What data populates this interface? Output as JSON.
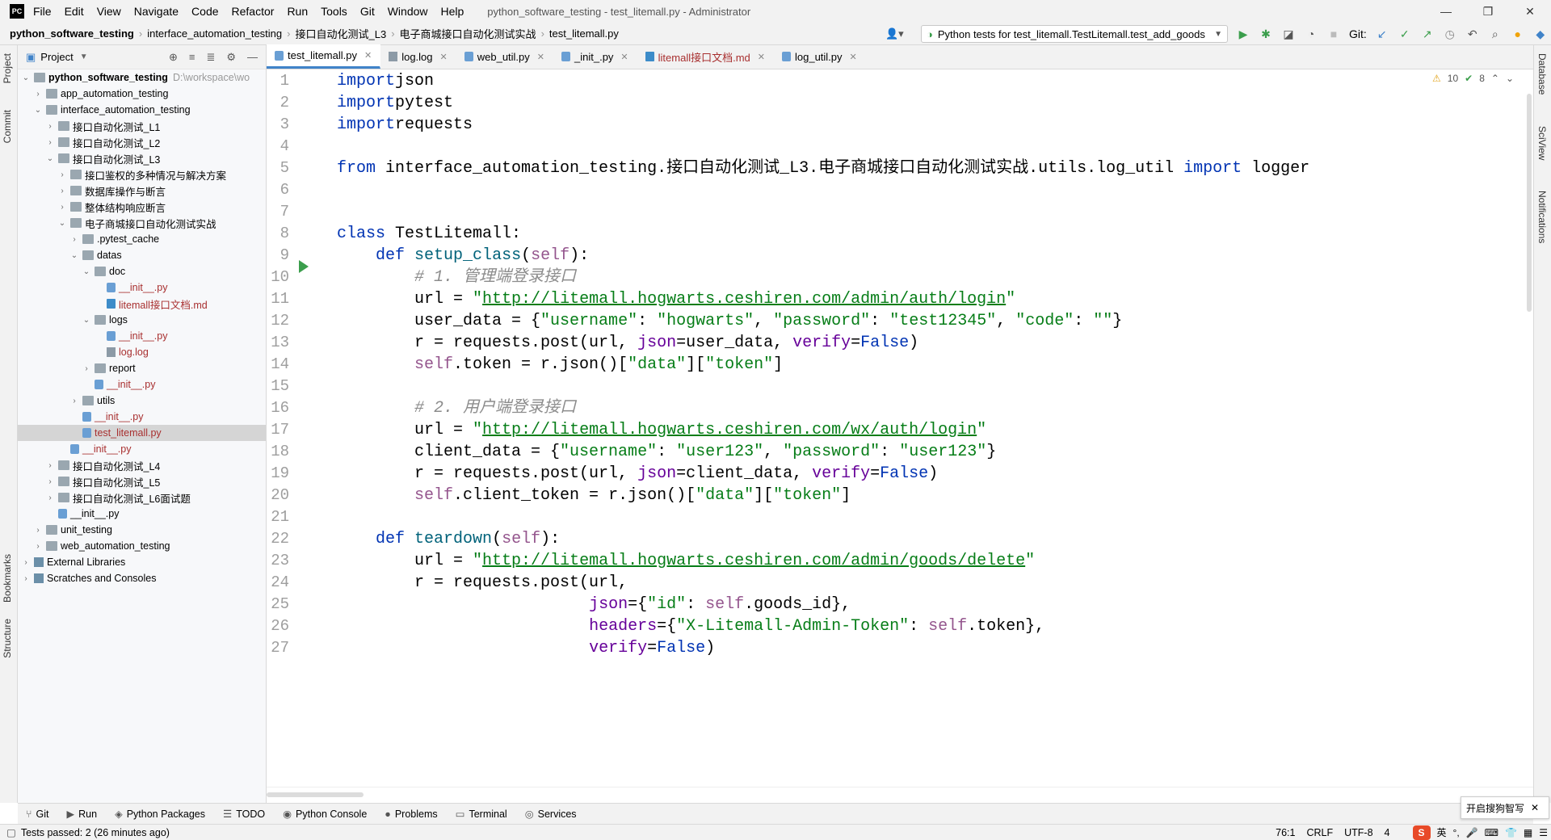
{
  "menubar": {
    "logo": "PC",
    "items": [
      "File",
      "Edit",
      "View",
      "Navigate",
      "Code",
      "Refactor",
      "Run",
      "Tools",
      "Git",
      "Window",
      "Help"
    ],
    "title": "python_software_testing - test_litemall.py - Administrator",
    "controls": [
      "—",
      "❐",
      "✕"
    ]
  },
  "navbar": {
    "breadcrumbs": [
      "python_software_testing",
      "interface_automation_testing",
      "接口自动化测试_L3",
      "电子商城接口自动化测试实战",
      "test_litemall.py"
    ],
    "run_config": "Python tests for test_litemall.TestLitemall.test_add_goods",
    "git_label": "Git:"
  },
  "left_strip": {
    "tabs": [
      "Project",
      "Commit",
      "Bookmarks",
      "Structure"
    ]
  },
  "right_strip": {
    "tabs": [
      "Database",
      "SciView",
      "Notifications"
    ]
  },
  "project": {
    "title": "Project",
    "tree": [
      {
        "label": "python_software_testing",
        "path": "D:\\workspace\\wo",
        "depth": 0,
        "chev": "v",
        "icon": "folder",
        "bold": true
      },
      {
        "label": "app_automation_testing",
        "depth": 1,
        "chev": ">",
        "icon": "folder"
      },
      {
        "label": "interface_automation_testing",
        "depth": 1,
        "chev": "v",
        "icon": "folder"
      },
      {
        "label": "接口自动化测试_L1",
        "depth": 2,
        "chev": ">",
        "icon": "folder"
      },
      {
        "label": "接口自动化测试_L2",
        "depth": 2,
        "chev": ">",
        "icon": "folder"
      },
      {
        "label": "接口自动化测试_L3",
        "depth": 2,
        "chev": "v",
        "icon": "folder"
      },
      {
        "label": "接口鉴权的多种情况与解决方案",
        "depth": 3,
        "chev": ">",
        "icon": "folder"
      },
      {
        "label": "数据库操作与断言",
        "depth": 3,
        "chev": ">",
        "icon": "folder"
      },
      {
        "label": "整体结构响应断言",
        "depth": 3,
        "chev": ">",
        "icon": "folder"
      },
      {
        "label": "电子商城接口自动化测试实战",
        "depth": 3,
        "chev": "v",
        "icon": "folder"
      },
      {
        "label": ".pytest_cache",
        "depth": 4,
        "chev": ">",
        "icon": "folder"
      },
      {
        "label": "datas",
        "depth": 4,
        "chev": "v",
        "icon": "folder"
      },
      {
        "label": "doc",
        "depth": 5,
        "chev": "v",
        "icon": "folder"
      },
      {
        "label": "__init__.py",
        "depth": 6,
        "chev": "",
        "icon": "py",
        "red": true
      },
      {
        "label": "litemall接口文档.md",
        "depth": 6,
        "chev": "",
        "icon": "md",
        "red": true
      },
      {
        "label": "logs",
        "depth": 5,
        "chev": "v",
        "icon": "folder"
      },
      {
        "label": "__init__.py",
        "depth": 6,
        "chev": "",
        "icon": "py",
        "red": true
      },
      {
        "label": "log.log",
        "depth": 6,
        "chev": "",
        "icon": "log",
        "red": true
      },
      {
        "label": "report",
        "depth": 5,
        "chev": ">",
        "icon": "folder"
      },
      {
        "label": "__init__.py",
        "depth": 5,
        "chev": "",
        "icon": "py",
        "red": true
      },
      {
        "label": "utils",
        "depth": 4,
        "chev": ">",
        "icon": "folder"
      },
      {
        "label": "__init__.py",
        "depth": 4,
        "chev": "",
        "icon": "py",
        "red": true
      },
      {
        "label": "test_litemall.py",
        "depth": 4,
        "chev": "",
        "icon": "py",
        "red": true,
        "selected": true
      },
      {
        "label": "__init__.py",
        "depth": 3,
        "chev": "",
        "icon": "py",
        "red": true
      },
      {
        "label": "接口自动化测试_L4",
        "depth": 2,
        "chev": ">",
        "icon": "folder"
      },
      {
        "label": "接口自动化测试_L5",
        "depth": 2,
        "chev": ">",
        "icon": "folder"
      },
      {
        "label": "接口自动化测试_L6面试题",
        "depth": 2,
        "chev": ">",
        "icon": "folder"
      },
      {
        "label": "__init__.py",
        "depth": 2,
        "chev": "",
        "icon": "py"
      },
      {
        "label": "unit_testing",
        "depth": 1,
        "chev": ">",
        "icon": "folder"
      },
      {
        "label": "web_automation_testing",
        "depth": 1,
        "chev": ">",
        "icon": "folder"
      },
      {
        "label": "External Libraries",
        "depth": 0,
        "chev": ">",
        "icon": "lib"
      },
      {
        "label": "Scratches and Consoles",
        "depth": 0,
        "chev": ">",
        "icon": "lib"
      }
    ]
  },
  "tabs": [
    {
      "label": "test_litemall.py",
      "active": true,
      "icon": "py"
    },
    {
      "label": "log.log",
      "icon": "log"
    },
    {
      "label": "web_util.py",
      "icon": "py"
    },
    {
      "label": "_init_.py",
      "icon": "py"
    },
    {
      "label": "litemall接口文档.md",
      "icon": "md",
      "red": true
    },
    {
      "label": "log_util.py",
      "icon": "py"
    }
  ],
  "inspection": {
    "warnings": "10",
    "ok": "8"
  },
  "code_lines": [
    [
      [
        "kw",
        "import"
      ],
      [
        "",
        "json"
      ]
    ],
    [
      [
        "kw",
        "import"
      ],
      [
        "",
        "pytest"
      ]
    ],
    [
      [
        "kw",
        "import"
      ],
      [
        "",
        "requests"
      ]
    ],
    [],
    [
      [
        "kw",
        "from"
      ],
      [
        "",
        " interface_automation_testing.接口自动化测试_L3.电子商城接口自动化测试实战.utils.log_util "
      ],
      [
        "kw",
        "import"
      ],
      [
        "",
        " logger"
      ]
    ],
    [],
    [],
    [
      [
        "kw",
        "class"
      ],
      [
        "",
        " TestLitemall:"
      ]
    ],
    [
      [
        "",
        "    "
      ],
      [
        "kw",
        "def"
      ],
      [
        "",
        " "
      ],
      [
        "fn",
        "setup_class"
      ],
      [
        "",
        "("
      ],
      [
        "slf",
        "self"
      ],
      [
        "",
        "):"
      ]
    ],
    [
      [
        "",
        "        "
      ],
      [
        "cmt",
        "# 1. 管理端登录接口"
      ]
    ],
    [
      [
        "",
        "        url = "
      ],
      [
        "str",
        "\""
      ],
      [
        "url",
        "http://litemall.hogwarts.ceshiren.com/admin/auth/login"
      ],
      [
        "str",
        "\""
      ]
    ],
    [
      [
        "",
        "        user_data = {"
      ],
      [
        "str",
        "\"username\""
      ],
      [
        "",
        ": "
      ],
      [
        "str",
        "\"hogwarts\""
      ],
      [
        "",
        ", "
      ],
      [
        "str",
        "\"password\""
      ],
      [
        "",
        ": "
      ],
      [
        "str",
        "\"test12345\""
      ],
      [
        "",
        ", "
      ],
      [
        "str",
        "\"code\""
      ],
      [
        "",
        ": "
      ],
      [
        "str",
        "\"\""
      ],
      [
        "",
        "}"
      ]
    ],
    [
      [
        "",
        "        r = requests.post(url, "
      ],
      [
        "prm",
        "json"
      ],
      [
        "",
        "=user_data, "
      ],
      [
        "prm",
        "verify"
      ],
      [
        "",
        "="
      ],
      [
        "kw",
        "False"
      ],
      [
        "",
        ")"
      ]
    ],
    [
      [
        "",
        "        "
      ],
      [
        "slf",
        "self"
      ],
      [
        "",
        ".token = r.json()["
      ],
      [
        "str",
        "\"data\""
      ],
      [
        "",
        "]["
      ],
      [
        "str",
        "\"token\""
      ],
      [
        "",
        "]"
      ]
    ],
    [],
    [
      [
        "",
        "        "
      ],
      [
        "cmt",
        "# 2. 用户端登录接口"
      ]
    ],
    [
      [
        "",
        "        url = "
      ],
      [
        "str",
        "\""
      ],
      [
        "url",
        "http://litemall.hogwarts.ceshiren.com/wx/auth/login"
      ],
      [
        "str",
        "\""
      ]
    ],
    [
      [
        "",
        "        client_data = {"
      ],
      [
        "str",
        "\"username\""
      ],
      [
        "",
        ": "
      ],
      [
        "str",
        "\"user123\""
      ],
      [
        "",
        ", "
      ],
      [
        "str",
        "\"password\""
      ],
      [
        "",
        ": "
      ],
      [
        "str",
        "\"user123\""
      ],
      [
        "",
        "}"
      ]
    ],
    [
      [
        "",
        "        r = requests.post(url, "
      ],
      [
        "prm",
        "json"
      ],
      [
        "",
        "=client_data, "
      ],
      [
        "prm",
        "verify"
      ],
      [
        "",
        "="
      ],
      [
        "kw",
        "False"
      ],
      [
        "",
        ")"
      ]
    ],
    [
      [
        "",
        "        "
      ],
      [
        "slf",
        "self"
      ],
      [
        "",
        ".client_token = r.json()["
      ],
      [
        "str",
        "\"data\""
      ],
      [
        "",
        "]["
      ],
      [
        "str",
        "\"token\""
      ],
      [
        "",
        "]"
      ]
    ],
    [],
    [
      [
        "",
        "    "
      ],
      [
        "kw",
        "def"
      ],
      [
        "",
        " "
      ],
      [
        "fn",
        "teardown"
      ],
      [
        "",
        "("
      ],
      [
        "slf",
        "self"
      ],
      [
        "",
        "):"
      ]
    ],
    [
      [
        "",
        "        url = "
      ],
      [
        "str",
        "\""
      ],
      [
        "url",
        "http://litemall.hogwarts.ceshiren.com/admin/goods/delete"
      ],
      [
        "str",
        "\""
      ]
    ],
    [
      [
        "",
        "        r = requests.post(url,"
      ]
    ],
    [
      [
        "",
        "                          "
      ],
      [
        "prm",
        "json"
      ],
      [
        "",
        "={"
      ],
      [
        "str",
        "\"id\""
      ],
      [
        "",
        ": "
      ],
      [
        "slf",
        "self"
      ],
      [
        "",
        ".goods_id},"
      ]
    ],
    [
      [
        "",
        "                          "
      ],
      [
        "prm",
        "headers"
      ],
      [
        "",
        "={"
      ],
      [
        "str",
        "\"X-Litemall-Admin-Token\""
      ],
      [
        "",
        ": "
      ],
      [
        "slf",
        "self"
      ],
      [
        "",
        ".token},"
      ]
    ],
    [
      [
        "",
        "                          "
      ],
      [
        "prm",
        "verify"
      ],
      [
        "",
        "="
      ],
      [
        "kw",
        "False"
      ],
      [
        "",
        ")"
      ]
    ]
  ],
  "toolwindows": [
    "Git",
    "Run",
    "Python Packages",
    "TODO",
    "Python Console",
    "Problems",
    "Terminal",
    "Services"
  ],
  "status": {
    "message": "Tests passed: 2 (26 minutes ago)",
    "position": "76:1",
    "line_sep": "CRLF",
    "encoding": "UTF-8",
    "indent": "4",
    "ime_lang": "英",
    "ime_popup": "开启搜狗智写"
  }
}
